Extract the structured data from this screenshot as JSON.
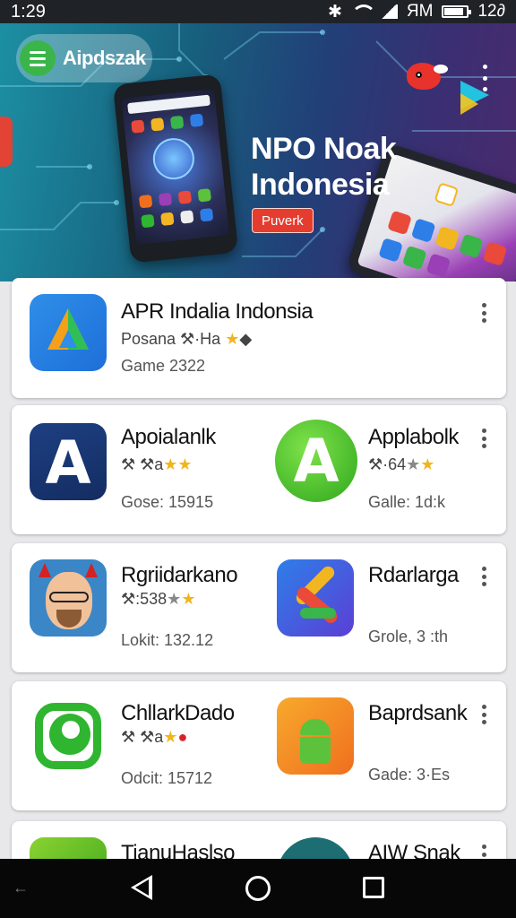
{
  "status_bar": {
    "time": "1:29",
    "right_text": "ЯМ",
    "clock_right": "12∂"
  },
  "header": {
    "app_name": "Aipdszak"
  },
  "banner": {
    "title_line1": "NPO Noak",
    "title_line2": "Indonesia",
    "badge": "Puverk"
  },
  "featured": {
    "title": "APR Indalia Indonsia",
    "subtitle": "Posana ⚒·Ha",
    "meta": "Game 2322"
  },
  "rows": [
    {
      "left": {
        "title": "Apoialanlk",
        "subtitle": "⚒ ⚒a",
        "meta": "Gose: 15915",
        "icon": "a-letter-navy-icon"
      },
      "right": {
        "title": "Applabolk",
        "subtitle": "⚒·64",
        "meta": "Galle: 1d:k",
        "icon": "a-letter-green-icon"
      }
    },
    {
      "left": {
        "title": "Rgriidarkano",
        "subtitle": "⚒:538",
        "meta": "Lokit: 132.12",
        "icon": "devil-avatar-icon"
      },
      "right": {
        "title": "Rdarlarga",
        "subtitle": "",
        "meta": "Grole, 3 :th",
        "icon": "colorful-arcs-icon"
      }
    },
    {
      "left": {
        "title": "ChllarkDado",
        "subtitle": "⚒ ⚒a",
        "meta": "Odcit: 15712",
        "icon": "chat-bubble-icon"
      },
      "right": {
        "title": "Baprdsank",
        "subtitle": "",
        "meta": "Gade: 3·Es",
        "icon": "android-robot-icon"
      }
    },
    {
      "left": {
        "title": "TianuHaslso",
        "subtitle": "",
        "meta": "",
        "icon": "green-app-icon"
      },
      "right": {
        "title": "AIW Snak",
        "subtitle": "",
        "meta": "",
        "icon": "teal-app-icon"
      }
    }
  ],
  "colors": {
    "accent_green": "#3bb54a",
    "badge_red": "#e43d2f",
    "star_gold": "#f1b51b"
  }
}
